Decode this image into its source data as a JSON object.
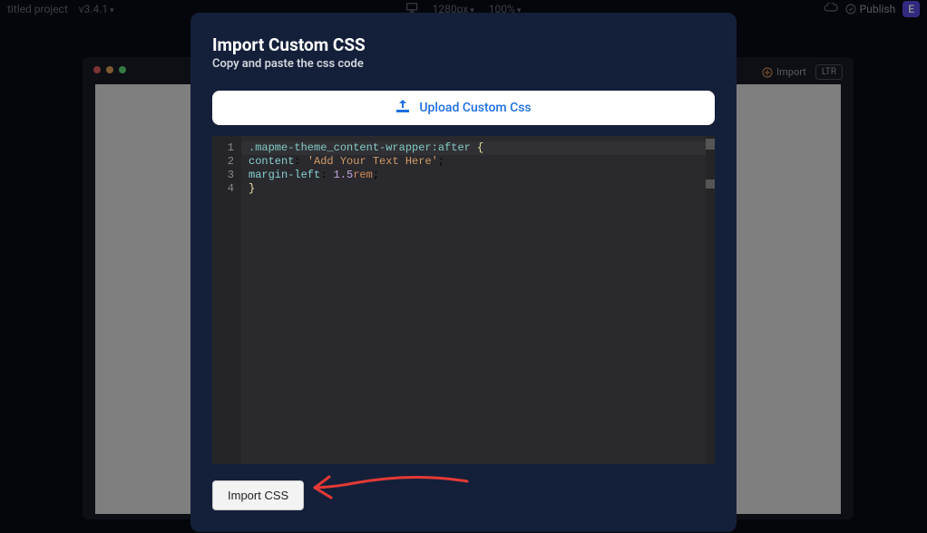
{
  "topbar": {
    "project_name": "titled project",
    "version": "v3.4.1",
    "viewport": "1280px",
    "zoom": "100%",
    "publish_label": "Publish",
    "export_label": "E"
  },
  "canvas": {
    "import_label": "Import",
    "ltr_label": "LTR"
  },
  "modal": {
    "title": "Import Custom CSS",
    "subtitle": "Copy and paste the css code",
    "upload_label": "Upload Custom Css",
    "import_btn_label": "Import CSS"
  },
  "editor": {
    "lines": [
      "1",
      "2",
      "3",
      "4"
    ],
    "code": {
      "l1_selector": ".mapme-theme_content-wrapper:after",
      "l1_brace": "{",
      "l2_prop": "content",
      "l2_val": "'Add Your Text Here'",
      "l3_prop": "margin-left",
      "l3_num": "1.5",
      "l3_unit": "rem",
      "l4_brace": "}"
    }
  }
}
